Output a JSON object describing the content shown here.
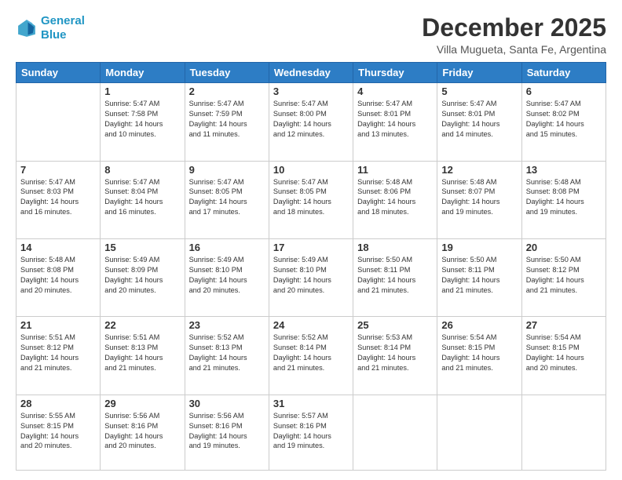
{
  "logo": {
    "line1": "General",
    "line2": "Blue"
  },
  "title": "December 2025",
  "subtitle": "Villa Mugueta, Santa Fe, Argentina",
  "days": [
    "Sunday",
    "Monday",
    "Tuesday",
    "Wednesday",
    "Thursday",
    "Friday",
    "Saturday"
  ],
  "weeks": [
    [
      {
        "day": "",
        "content": ""
      },
      {
        "day": "1",
        "content": "Sunrise: 5:47 AM\nSunset: 7:58 PM\nDaylight: 14 hours\nand 10 minutes."
      },
      {
        "day": "2",
        "content": "Sunrise: 5:47 AM\nSunset: 7:59 PM\nDaylight: 14 hours\nand 11 minutes."
      },
      {
        "day": "3",
        "content": "Sunrise: 5:47 AM\nSunset: 8:00 PM\nDaylight: 14 hours\nand 12 minutes."
      },
      {
        "day": "4",
        "content": "Sunrise: 5:47 AM\nSunset: 8:01 PM\nDaylight: 14 hours\nand 13 minutes."
      },
      {
        "day": "5",
        "content": "Sunrise: 5:47 AM\nSunset: 8:01 PM\nDaylight: 14 hours\nand 14 minutes."
      },
      {
        "day": "6",
        "content": "Sunrise: 5:47 AM\nSunset: 8:02 PM\nDaylight: 14 hours\nand 15 minutes."
      }
    ],
    [
      {
        "day": "7",
        "content": "Sunrise: 5:47 AM\nSunset: 8:03 PM\nDaylight: 14 hours\nand 16 minutes."
      },
      {
        "day": "8",
        "content": "Sunrise: 5:47 AM\nSunset: 8:04 PM\nDaylight: 14 hours\nand 16 minutes."
      },
      {
        "day": "9",
        "content": "Sunrise: 5:47 AM\nSunset: 8:05 PM\nDaylight: 14 hours\nand 17 minutes."
      },
      {
        "day": "10",
        "content": "Sunrise: 5:47 AM\nSunset: 8:05 PM\nDaylight: 14 hours\nand 18 minutes."
      },
      {
        "day": "11",
        "content": "Sunrise: 5:48 AM\nSunset: 8:06 PM\nDaylight: 14 hours\nand 18 minutes."
      },
      {
        "day": "12",
        "content": "Sunrise: 5:48 AM\nSunset: 8:07 PM\nDaylight: 14 hours\nand 19 minutes."
      },
      {
        "day": "13",
        "content": "Sunrise: 5:48 AM\nSunset: 8:08 PM\nDaylight: 14 hours\nand 19 minutes."
      }
    ],
    [
      {
        "day": "14",
        "content": "Sunrise: 5:48 AM\nSunset: 8:08 PM\nDaylight: 14 hours\nand 20 minutes."
      },
      {
        "day": "15",
        "content": "Sunrise: 5:49 AM\nSunset: 8:09 PM\nDaylight: 14 hours\nand 20 minutes."
      },
      {
        "day": "16",
        "content": "Sunrise: 5:49 AM\nSunset: 8:10 PM\nDaylight: 14 hours\nand 20 minutes."
      },
      {
        "day": "17",
        "content": "Sunrise: 5:49 AM\nSunset: 8:10 PM\nDaylight: 14 hours\nand 20 minutes."
      },
      {
        "day": "18",
        "content": "Sunrise: 5:50 AM\nSunset: 8:11 PM\nDaylight: 14 hours\nand 21 minutes."
      },
      {
        "day": "19",
        "content": "Sunrise: 5:50 AM\nSunset: 8:11 PM\nDaylight: 14 hours\nand 21 minutes."
      },
      {
        "day": "20",
        "content": "Sunrise: 5:50 AM\nSunset: 8:12 PM\nDaylight: 14 hours\nand 21 minutes."
      }
    ],
    [
      {
        "day": "21",
        "content": "Sunrise: 5:51 AM\nSunset: 8:12 PM\nDaylight: 14 hours\nand 21 minutes."
      },
      {
        "day": "22",
        "content": "Sunrise: 5:51 AM\nSunset: 8:13 PM\nDaylight: 14 hours\nand 21 minutes."
      },
      {
        "day": "23",
        "content": "Sunrise: 5:52 AM\nSunset: 8:13 PM\nDaylight: 14 hours\nand 21 minutes."
      },
      {
        "day": "24",
        "content": "Sunrise: 5:52 AM\nSunset: 8:14 PM\nDaylight: 14 hours\nand 21 minutes."
      },
      {
        "day": "25",
        "content": "Sunrise: 5:53 AM\nSunset: 8:14 PM\nDaylight: 14 hours\nand 21 minutes."
      },
      {
        "day": "26",
        "content": "Sunrise: 5:54 AM\nSunset: 8:15 PM\nDaylight: 14 hours\nand 21 minutes."
      },
      {
        "day": "27",
        "content": "Sunrise: 5:54 AM\nSunset: 8:15 PM\nDaylight: 14 hours\nand 20 minutes."
      }
    ],
    [
      {
        "day": "28",
        "content": "Sunrise: 5:55 AM\nSunset: 8:15 PM\nDaylight: 14 hours\nand 20 minutes."
      },
      {
        "day": "29",
        "content": "Sunrise: 5:56 AM\nSunset: 8:16 PM\nDaylight: 14 hours\nand 20 minutes."
      },
      {
        "day": "30",
        "content": "Sunrise: 5:56 AM\nSunset: 8:16 PM\nDaylight: 14 hours\nand 19 minutes."
      },
      {
        "day": "31",
        "content": "Sunrise: 5:57 AM\nSunset: 8:16 PM\nDaylight: 14 hours\nand 19 minutes."
      },
      {
        "day": "",
        "content": ""
      },
      {
        "day": "",
        "content": ""
      },
      {
        "day": "",
        "content": ""
      }
    ]
  ]
}
